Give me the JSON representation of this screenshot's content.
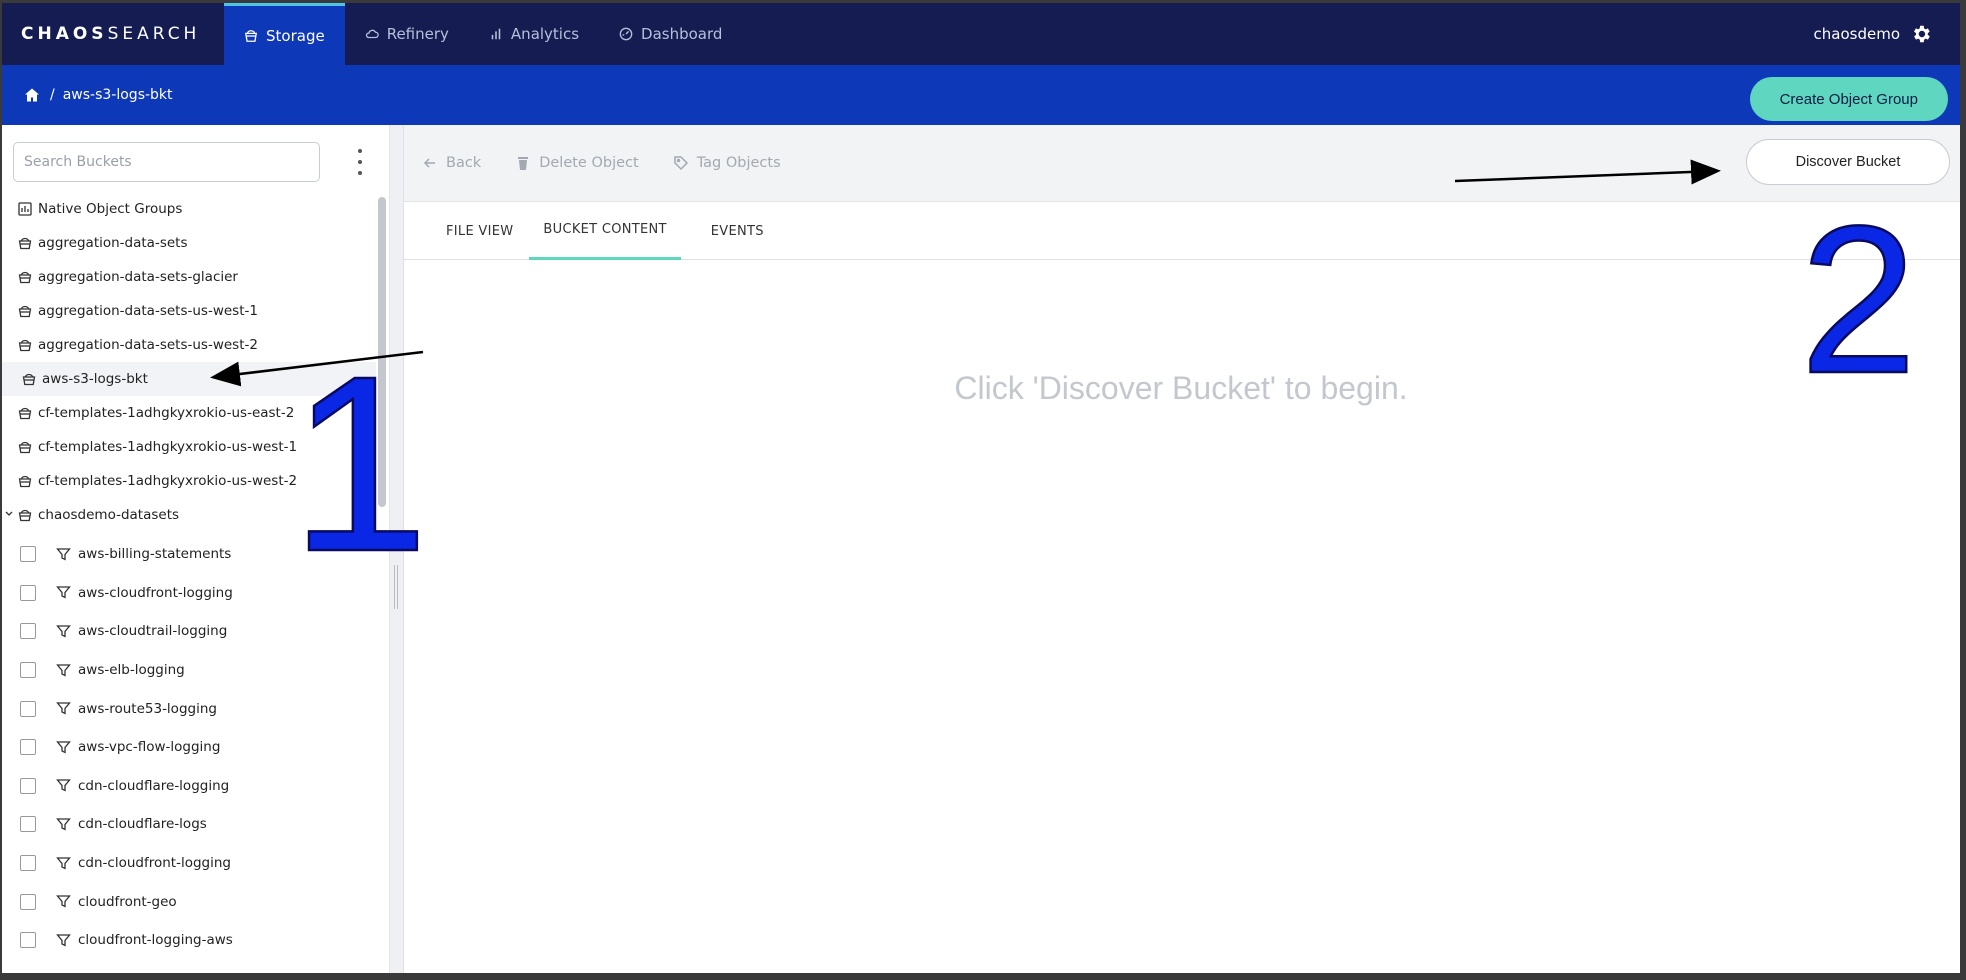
{
  "app": {
    "logo_bold": "CHAOS",
    "logo_light": "SEARCH",
    "user": "chaosdemo"
  },
  "nav": {
    "tabs": [
      {
        "label": "Storage",
        "icon": "bucket-icon",
        "active": true
      },
      {
        "label": "Refinery",
        "icon": "cloud-icon",
        "active": false
      },
      {
        "label": "Analytics",
        "icon": "bar-chart-icon",
        "active": false
      },
      {
        "label": "Dashboard",
        "icon": "dashboard-icon",
        "active": false
      }
    ]
  },
  "breadcrumb": {
    "separator": "/",
    "current": "aws-s3-logs-bkt"
  },
  "actions": {
    "create_object_group": "Create Object Group",
    "discover_bucket": "Discover Bucket"
  },
  "sidebar": {
    "search_placeholder": "Search Buckets",
    "items": [
      {
        "label": "Native Object Groups",
        "icon": "chart-box-icon"
      },
      {
        "label": "aggregation-data-sets",
        "icon": "bucket-icon"
      },
      {
        "label": "aggregation-data-sets-glacier",
        "icon": "bucket-icon"
      },
      {
        "label": "aggregation-data-sets-us-west-1",
        "icon": "bucket-icon"
      },
      {
        "label": "aggregation-data-sets-us-west-2",
        "icon": "bucket-icon"
      },
      {
        "label": "aws-s3-logs-bkt",
        "icon": "bucket-icon",
        "selected": true
      },
      {
        "label": "cf-templates-1adhgkyxrokio-us-east-2",
        "icon": "bucket-icon"
      },
      {
        "label": "cf-templates-1adhgkyxrokio-us-west-1",
        "icon": "bucket-icon"
      },
      {
        "label": "cf-templates-1adhgkyxrokio-us-west-2",
        "icon": "bucket-icon"
      }
    ],
    "group": {
      "label": "chaosdemo-datasets",
      "expanded": true,
      "children": [
        "aws-billing-statements",
        "aws-cloudfront-logging",
        "aws-cloudtrail-logging",
        "aws-elb-logging",
        "aws-route53-logging",
        "aws-vpc-flow-logging",
        "cdn-cloudflare-logging",
        "cdn-cloudflare-logs",
        "cdn-cloudfront-logging",
        "cloudfront-geo",
        "cloudfront-logging-aws"
      ]
    }
  },
  "toolbar": {
    "back": "Back",
    "delete_object": "Delete Object",
    "tag_objects": "Tag Objects"
  },
  "tabs": {
    "file_view": "FILE VIEW",
    "bucket_content": "BUCKET CONTENT",
    "events": "EVENTS",
    "active": "BUCKET CONTENT"
  },
  "main": {
    "empty_message": "Click 'Discover Bucket' to begin."
  },
  "annotations": {
    "step_1": "1",
    "step_2": "2"
  },
  "colors": {
    "nav_bg": "#141c52",
    "active_tab_bg": "#0d38b8",
    "breadcrumb_bg": "#0d38b8",
    "accent_teal": "#5ed6c0",
    "annotation_blue": "#0a27e6"
  }
}
